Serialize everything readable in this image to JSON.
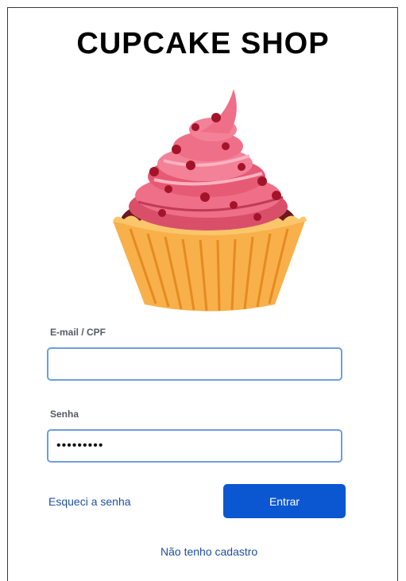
{
  "header": {
    "title": "CUPCAKE SHOP"
  },
  "image": {
    "icon": "cupcake-illustration"
  },
  "form": {
    "email_label": "E-mail / CPF",
    "email_value": "",
    "password_label": "Senha",
    "password_value": "•••••••••"
  },
  "actions": {
    "forgot_password": "Esqueci a senha",
    "submit": "Entrar",
    "register": "Não tenho cadastro"
  },
  "colors": {
    "accent": "#0a57d1",
    "input_border": "#6f9edb",
    "link": "#1f4fa3"
  }
}
